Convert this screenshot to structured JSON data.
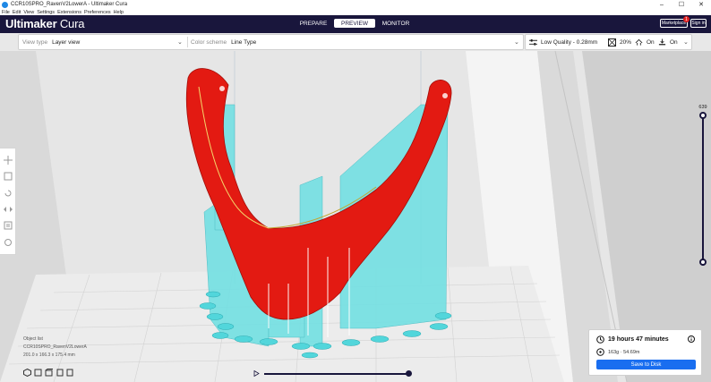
{
  "window": {
    "title": "CCR10SPRO_RavenV2LowerA - Ultimaker Cura",
    "minimize_glyph": "–",
    "maximize_glyph": "☐",
    "close_glyph": "✕"
  },
  "menu": [
    "File",
    "Edit",
    "View",
    "Settings",
    "Extensions",
    "Preferences",
    "Help"
  ],
  "header": {
    "brand_bold": "Ultimaker",
    "brand_light": " Cura",
    "tabs": [
      "PREPARE",
      "PREVIEW",
      "MONITOR"
    ],
    "active_tab": "PREVIEW",
    "marketplace_label": "Marketplace",
    "marketplace_badge": "1",
    "signin_label": "Sign in"
  },
  "view_panel": {
    "view_type_label": "View type",
    "view_type_value": "Layer view",
    "color_scheme_label": "Color scheme",
    "color_scheme_value": "Line Type"
  },
  "print_settings": {
    "profile": "Low Quality - 0.28mm",
    "infill": "20%",
    "support": "On",
    "adhesion": "On"
  },
  "layer_slider": {
    "current_layer": "639"
  },
  "objects": {
    "header": "Object list",
    "file_name": "CCR10SPRO_RavenV2LowerA",
    "dimensions": "201.0 x 166.3 x 175.4 mm"
  },
  "summary": {
    "print_time": "19 hours 47 minutes",
    "material": "163g · 54.69m",
    "save_label": "Save to Disk"
  },
  "colors": {
    "header_bg": "#19163c",
    "model_wall": "#e31a12",
    "support": "#73e0e3",
    "accent": "#196ef0"
  },
  "icons": {
    "settings": "sliders-icon",
    "infill": "infill-icon",
    "support": "support-icon",
    "adhesion": "adhesion-icon"
  }
}
